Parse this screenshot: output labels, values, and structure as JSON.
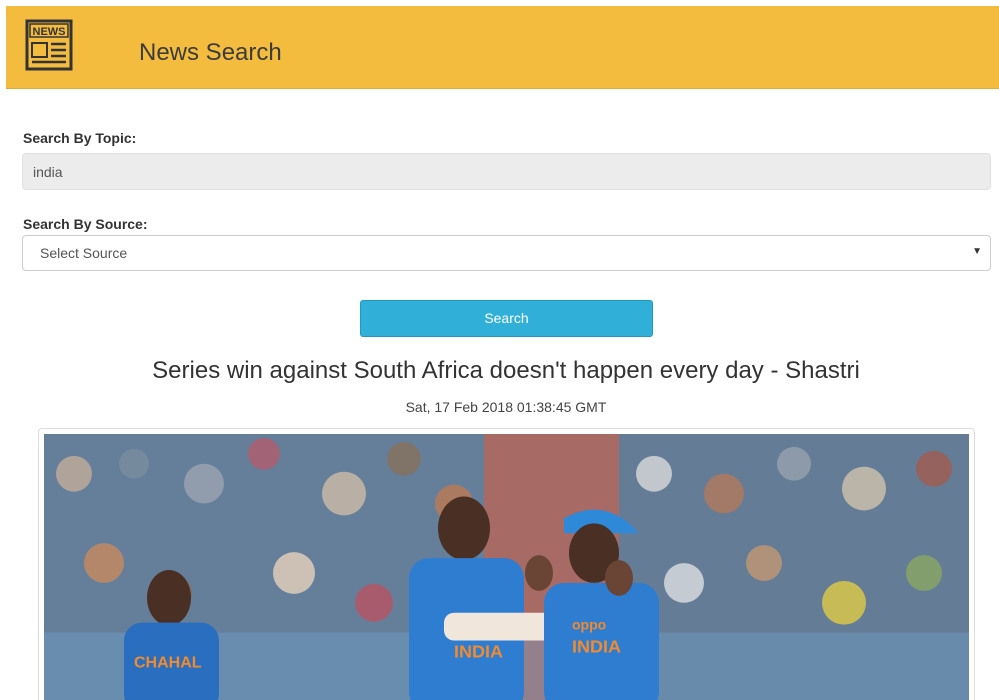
{
  "header": {
    "logo_text": "NEWS",
    "brand": "News Search",
    "brand_color": "#f4bc3f"
  },
  "topic": {
    "label": "Search By Topic:",
    "value": "india"
  },
  "source": {
    "label": "Search By Source:",
    "selected": "Select Source"
  },
  "search_button": {
    "label": "Search",
    "color": "#30b0d8"
  },
  "article": {
    "title": "Series win against South Africa doesn't happen every day - Shastri",
    "date": "Sat, 17 Feb 2018 01:38:45 GMT",
    "image_icon": "cricket-photo",
    "jersey_texts": [
      "CHAHAL",
      "INDIA",
      "oppo",
      "INDIA"
    ]
  }
}
